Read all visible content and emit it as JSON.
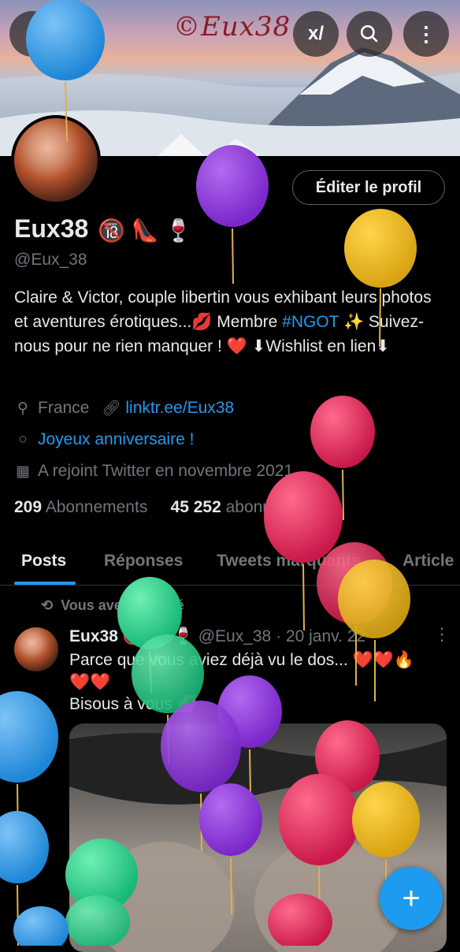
{
  "banner": {
    "watermark": "©Eux38"
  },
  "topbar": {
    "back_icon": "arrow-left-icon",
    "grok_label": "x/",
    "search_icon": "search-icon",
    "more_icon": "more-vertical-icon"
  },
  "profile": {
    "edit_label": "Éditer le profil",
    "name": "Eux38",
    "name_emojis": "🔞 👠 🍷",
    "handle": "@Eux_38",
    "bio_part1": "Claire & Victor, couple libertin vous exhibant leurs photos et aventures érotiques...💋 Membre ",
    "bio_hashtag": "#NGOT",
    "bio_part2": " ✨ Suivez-nous pour ne rien manquer ! ❤️  ⬇Wishlist en lien⬇",
    "location": "France",
    "website": "linktr.ee/Eux38",
    "birthday": "Joyeux anniversaire !",
    "joined": "A rejoint Twitter en novembre 2021",
    "following_count": "209",
    "following_label": "Abonnements",
    "followers_count": "45 252",
    "followers_label": "abonnés"
  },
  "tabs": [
    {
      "label": "Posts"
    },
    {
      "label": "Réponses"
    },
    {
      "label": "Tweets marquants"
    },
    {
      "label": "Article"
    }
  ],
  "post": {
    "repost_label": "Vous avez reposté",
    "author_name": "Eux38",
    "author_emojis": "🔞 👠 🍷",
    "author_handle": "@Eux_38",
    "date": "· 20 janv. 22",
    "line1": "Parce que vous aviez déjà vu le dos... ❤️❤️🔥",
    "line2": "❤️❤️",
    "line3": "Bisous à vous 💋"
  },
  "fab": {
    "label": "+"
  },
  "colors": {
    "accent": "#1d9bf0",
    "muted": "#71767b",
    "text": "#e7e9ea"
  }
}
